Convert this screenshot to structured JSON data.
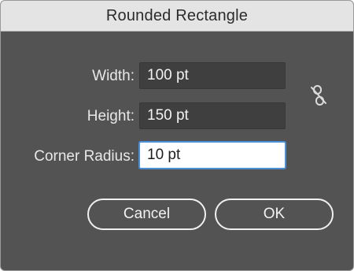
{
  "dialog": {
    "title": "Rounded Rectangle"
  },
  "fields": {
    "width": {
      "label": "Width:",
      "value": "100 pt"
    },
    "height": {
      "label": "Height:",
      "value": "150 pt"
    },
    "corner_radius": {
      "label": "Corner Radius:",
      "value": "10 pt"
    }
  },
  "constrain_proportions": {
    "icon": "unlinked-chain-icon",
    "state": "off"
  },
  "buttons": {
    "cancel_label": "Cancel",
    "ok_label": "OK"
  },
  "colors": {
    "dialog_bg": "#535353",
    "titlebar_bg": "#e4e4e4",
    "field_bg": "#3f3f3f",
    "focus_ring": "#4a90d9"
  }
}
